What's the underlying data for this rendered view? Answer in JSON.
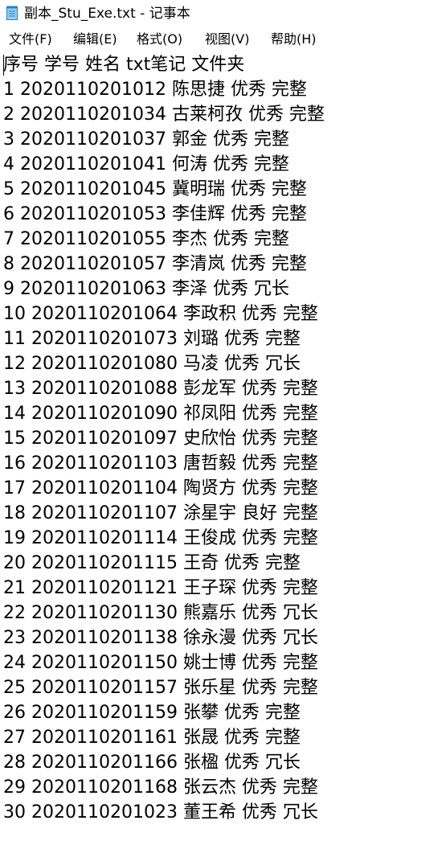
{
  "window": {
    "title": "副本_Stu_Exe.txt - 记事本",
    "icon": "notepad-icon"
  },
  "menu": {
    "file": "文件(F)",
    "edit": "编辑(E)",
    "format": "格式(O)",
    "view": "视图(V)",
    "help": "帮助(H)"
  },
  "document": {
    "lines": [
      "序号 学号 姓名 txt笔记 文件夹",
      "1 2020110201012 陈思捷 优秀 完整",
      "2 2020110201034 古莱柯孜 优秀 完整",
      "3 2020110201037 郭金 优秀 完整",
      "4 2020110201041 何涛 优秀 完整",
      "5 2020110201045 冀明瑞 优秀 完整",
      "6 2020110201053 李佳辉 优秀 完整",
      "7 2020110201055 李杰 优秀 完整",
      "8 2020110201057 李清岚 优秀 完整",
      "9 2020110201063 李泽 优秀 冗长",
      "10 2020110201064 李政积 优秀 完整",
      "11 2020110201073 刘璐 优秀 完整",
      "12 2020110201080 马凌 优秀 冗长",
      "13 2020110201088 彭龙军 优秀 完整",
      "14 2020110201090 祁凤阳 优秀 完整",
      "15 2020110201097 史欣怡 优秀 完整",
      "16 2020110201103 唐哲毅 优秀 完整",
      "17 2020110201104 陶贤方 优秀 完整",
      "18 2020110201107 涂星宇 良好 完整",
      "19 2020110201114 王俊成 优秀 完整",
      "20 2020110201115 王奇 优秀 完整",
      "21 2020110201121 王子琛 优秀 完整",
      "22 2020110201130 熊嘉乐 优秀 冗长",
      "23 2020110201138 徐永漫 优秀 冗长",
      "24 2020110201150 姚士博 优秀 完整",
      "25 2020110201157 张乐星 优秀 完整",
      "26 2020110201159 张攀 优秀 完整",
      "27 2020110201161 张晟 优秀 完整",
      "28 2020110201166 张楹 优秀 冗长",
      "29 2020110201168 张云杰 优秀 完整",
      "30 2020110201023 董王希 优秀 冗长"
    ]
  }
}
